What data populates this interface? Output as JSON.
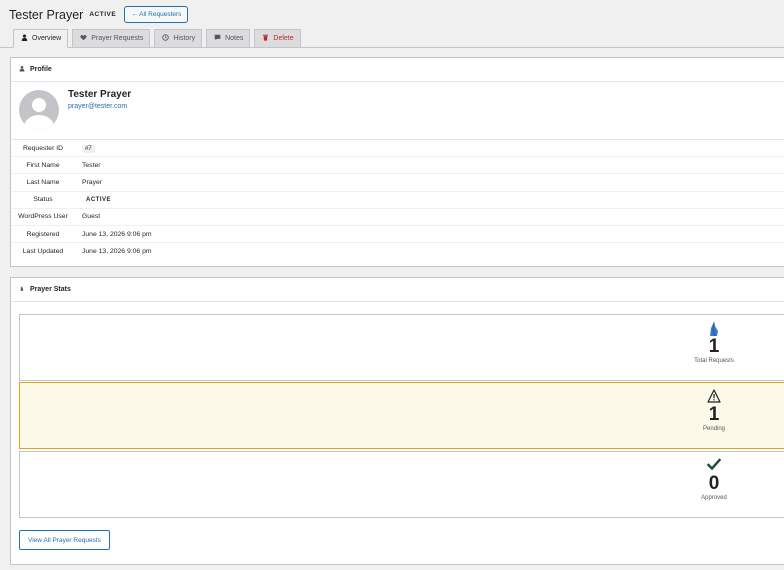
{
  "header": {
    "title": "Tester Prayer",
    "status_badge": "ACTIVE",
    "back_button": "← All Requesters"
  },
  "tabs": [
    {
      "label": "Overview",
      "icon": "person-icon",
      "active": true
    },
    {
      "label": "Prayer Requests",
      "icon": "heart-icon"
    },
    {
      "label": "History",
      "icon": "clock-icon"
    },
    {
      "label": "Notes",
      "icon": "note-icon"
    },
    {
      "label": "Delete",
      "icon": "trash-icon"
    }
  ],
  "profile": {
    "heading": "Profile",
    "name": "Tester Prayer",
    "email": "prayer@tester.com",
    "rows": [
      {
        "label": "Requester ID",
        "value": "#7"
      },
      {
        "label": "First Name",
        "value": "Tester"
      },
      {
        "label": "Last Name",
        "value": "Prayer"
      },
      {
        "label": "Status",
        "value": "ACTIVE"
      },
      {
        "label": "WordPress User",
        "value": "Guest"
      },
      {
        "label": "Registered",
        "value": "June 13, 2026 9:06 pm"
      },
      {
        "label": "Last Updated",
        "value": "June 13, 2026 9:06 pm"
      }
    ]
  },
  "stats": {
    "heading": "Prayer Stats",
    "cards": [
      {
        "value": "1",
        "label": "Total Requests",
        "icon": "praying-hands-icon",
        "color": "#3c78c8"
      },
      {
        "value": "1",
        "label": "Pending",
        "icon": "warning-icon",
        "color": "#1d2327"
      },
      {
        "value": "0",
        "label": "Approved",
        "icon": "checkmark-icon",
        "color": "#1d4a3a"
      }
    ],
    "view_all_button": "View All Prayer Requests"
  },
  "colors": {
    "accent": "#2271b1",
    "pending_bg": "#fcf9e8",
    "pending_border": "#dba617",
    "delete": "#b32d2e"
  }
}
